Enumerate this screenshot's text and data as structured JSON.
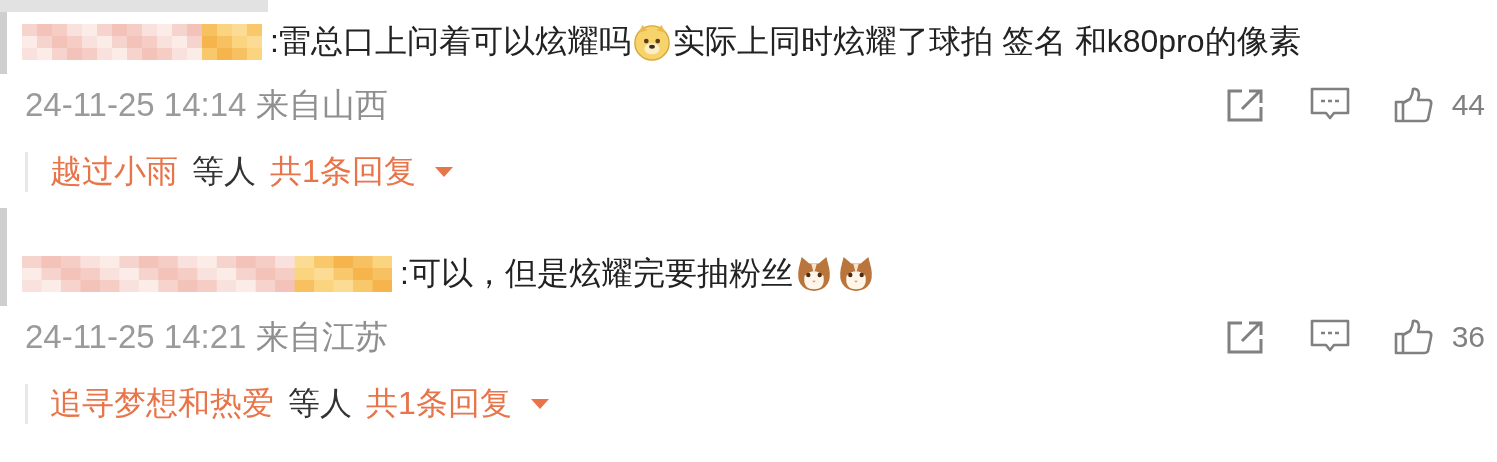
{
  "comments": [
    {
      "content": [
        {
          "kind": "text",
          "text": ":雷总口上问着可以炫耀吗"
        },
        {
          "kind": "dog"
        },
        {
          "kind": "text",
          "text": "实际上同时炫耀了球拍 签名 和k80pro的像素"
        }
      ],
      "date": "24-11-25 14:14",
      "location": "来自山西",
      "likes": "44",
      "replies": {
        "user": "越过小雨",
        "suffix": "等人",
        "count": "共1条回复"
      }
    },
    {
      "content": [
        {
          "kind": "text",
          "text": ":可以，但是炫耀完要抽粉丝"
        },
        {
          "kind": "cat"
        },
        {
          "kind": "cat"
        }
      ],
      "date": "24-11-25 14:21",
      "location": "来自江苏",
      "likes": "36",
      "replies": {
        "user": "追寻梦想和热爱",
        "suffix": "等人",
        "count": "共1条回复"
      }
    }
  ]
}
